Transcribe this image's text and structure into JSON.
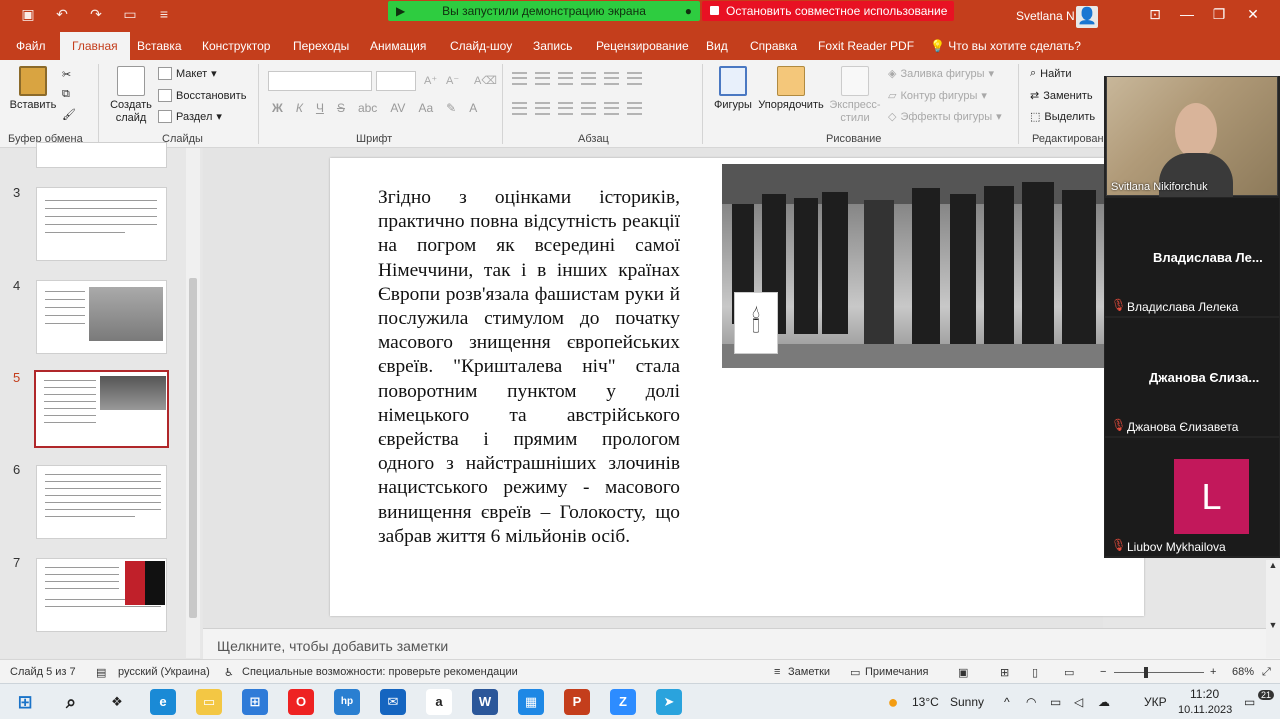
{
  "titlebar": {
    "share_status": "Вы запустили демонстрацию экрана",
    "stop_share": "Остановить совместное использование",
    "user_name": "Svetlana N"
  },
  "tabs": [
    "Файл",
    "Главная",
    "Вставка",
    "Конструктор",
    "Переходы",
    "Анимация",
    "Слайд-шоу",
    "Запись",
    "Рецензирование",
    "Вид",
    "Справка",
    "Foxit Reader PDF",
    "Что вы хотите сделать?"
  ],
  "ribbon": {
    "clipboard": {
      "paste": "Вставить",
      "group": "Буфер обмена"
    },
    "slides": {
      "new_slide": "Создать",
      "new_slide2": "слайд",
      "layout": "Макет",
      "reset": "Восстановить",
      "section": "Раздел",
      "group": "Слайды"
    },
    "font": {
      "group": "Шрифт",
      "bold": "Ж",
      "italic": "К",
      "underline": "Ч",
      "strike": "S",
      "shadow": "abc",
      "spacing": "AV",
      "case": "Aa",
      "color": "A"
    },
    "paragraph": {
      "group": "Абзац"
    },
    "drawing": {
      "shapes": "Фигуры",
      "arrange": "Упорядочить",
      "styles1": "Экспресс-",
      "styles2": "стили",
      "fill": "Заливка фигуры",
      "outline": "Контур фигуры",
      "effects": "Эффекты фигуры",
      "group": "Рисование"
    },
    "editing": {
      "find": "Найти",
      "replace": "Заменить",
      "select": "Выделить",
      "group": "Редактирования"
    }
  },
  "thumbnails": [
    {
      "num": "3"
    },
    {
      "num": "4"
    },
    {
      "num": "5"
    },
    {
      "num": "6"
    },
    {
      "num": "7"
    }
  ],
  "slide": {
    "text": "Згідно з оцінками істориків, практично повна відсутність реакції на погром як всередині самої Німеччини, так і в інших країнах Європи розв'язала фашистам руки й послужила стимулом до початку масового знищення європейських євреїв. \"Кришталева ніч\" стала поворотним пунктом у долі німецького та австрійського єврейства і прямим прологом одного з найстрашніших злочинів нацистського режиму - масового винищення євреїв – Голокосту, що забрав життя 6 мільйонів осіб."
  },
  "notes_placeholder": "Щелкните, чтобы добавить заметки",
  "status": {
    "slide_of": "Слайд 5 из 7",
    "language": "русский (Украина)",
    "accessibility": "Специальные возможности: проверьте рекомендации",
    "notes": "Заметки",
    "comments": "Примечания",
    "zoom": "68%"
  },
  "participants": [
    {
      "name": "Svitlana Nikiforchuk"
    },
    {
      "name_big": "Владислава  Ле...",
      "name": "Владислава Лелека"
    },
    {
      "name_big": "Джанова Єлиза...",
      "name": "Джанова Єлизавета"
    },
    {
      "initial": "L",
      "name": "Liubov Mykhailova"
    }
  ],
  "taskbar": {
    "weather_temp": "13°C",
    "weather_desc": "Sunny",
    "lang": "УКР",
    "time": "11:20",
    "date": "10.11.2023",
    "notif_count": "21"
  }
}
